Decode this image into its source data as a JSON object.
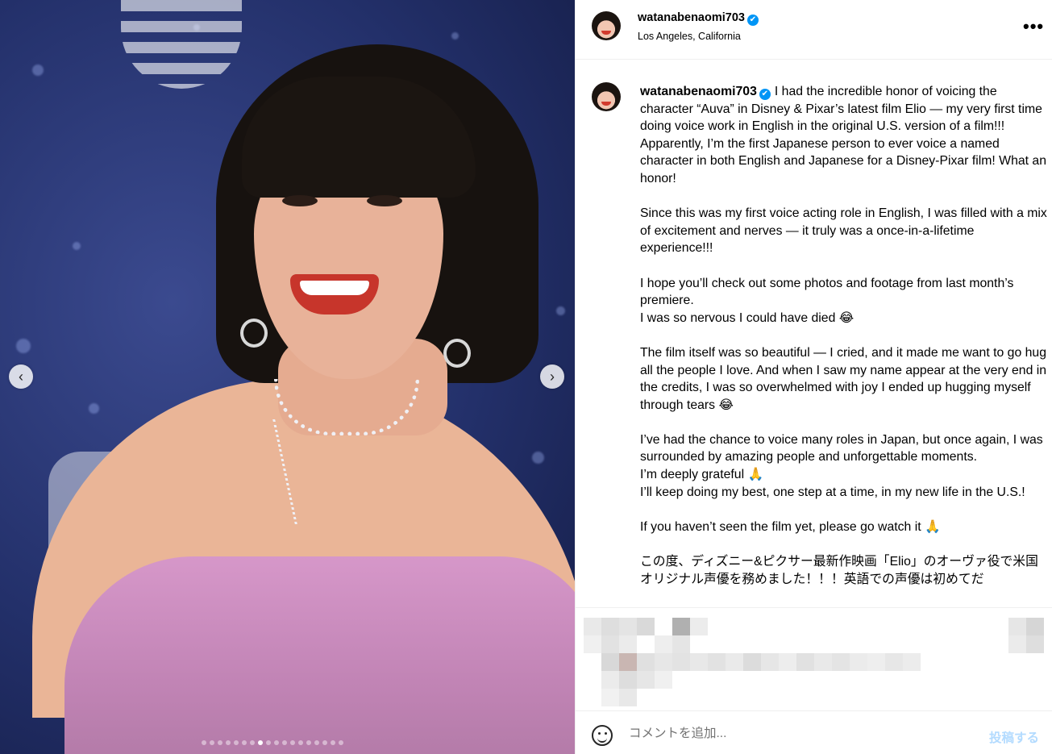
{
  "post": {
    "username": "watanabenaomi703",
    "verified_icon": "✔",
    "location": "Los Angeles, California",
    "more_label": "•••",
    "caption": "I had the incredible honor of voicing the character “Auva” in Disney & Pixar’s latest film Elio — my very first time doing voice work in English in the original U.S. version of a film!!! Apparently, I’m the first Japanese person to ever voice a named character in both English and Japanese for a Disney-Pixar film! What an honor!\n\nSince this was my first voice acting role in English, I was filled with a mix of excitement and nerves — it truly was a once-in-a-lifetime experience!!!\n\nI hope you’ll check out some photos and footage from last month’s premiere.\nI was so nervous I could have died 😂\n\nThe film itself was so beautiful — I cried, and it made me want to go hug all the people I love. And when I saw my name appear at the very end in the credits, I was so overwhelmed with joy I ended up hugging myself through tears 😂\n\nI’ve had the chance to voice many roles in Japan, but once again, I was surrounded by amazing people and unforgettable moments.\nI’m deeply grateful 🙏\nI’ll keep doing my best, one step at a time, in my new life in the U.S.!\n\nIf you haven’t seen the film yet, please go watch it 🙏\n\nこの度、ディズニー&ピクサー最新作映画「Elio」のオーヴァ役で米国オリジナル声優を務めました！！！英語での声優は初めてだ"
  },
  "media": {
    "prev_icon": "‹",
    "next_icon": "›",
    "slide_count": 18,
    "active_slide": 7
  },
  "comment_box": {
    "placeholder": "コメントを追加...",
    "post_label": "投稿する"
  },
  "colors": {
    "accent": "#0095f6",
    "post_disabled": "#b3dbff",
    "dress": "#c184b5",
    "backdrop": "#23306a"
  }
}
